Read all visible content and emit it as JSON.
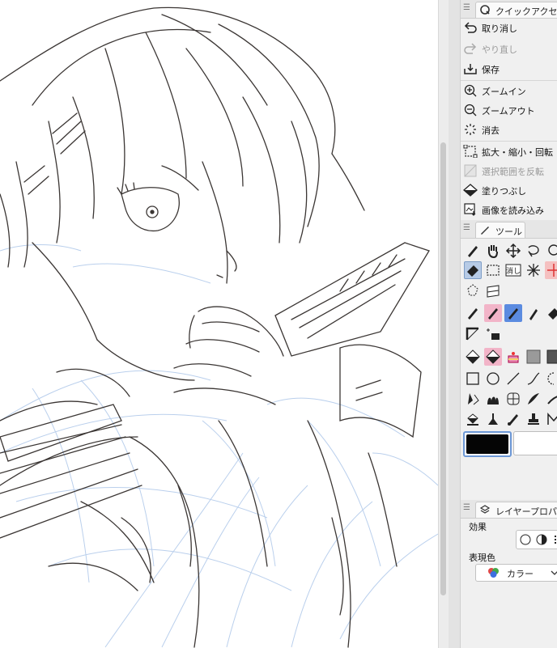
{
  "quick_access": {
    "tab_label": "クイックアクセス",
    "items": [
      {
        "label": "取り消し",
        "icon": "undo-icon",
        "disabled": false
      },
      {
        "label": "やり直し",
        "icon": "redo-icon",
        "disabled": true
      },
      {
        "label": "保存",
        "icon": "save-icon",
        "disabled": false
      },
      {
        "label": "ズームイン",
        "icon": "zoom-in-icon",
        "disabled": false
      },
      {
        "label": "ズームアウト",
        "icon": "zoom-out-icon",
        "disabled": false
      },
      {
        "label": "消去",
        "icon": "clear-icon",
        "disabled": false
      },
      {
        "label": "拡大・縮小・回転",
        "icon": "transform-icon",
        "disabled": false
      },
      {
        "label": "選択範囲を反転",
        "icon": "invert-selection-icon",
        "disabled": true
      },
      {
        "label": "塗りつぶし",
        "icon": "fill-icon",
        "disabled": false
      },
      {
        "label": "画像を読み込み",
        "icon": "import-image-icon",
        "disabled": false
      }
    ]
  },
  "tool_panel": {
    "tab_label": "ツール",
    "clear_button_label": "消し"
  },
  "colors": {
    "main": "#050505",
    "sub": "#ffffff",
    "accent": "#6d98d6"
  },
  "layer_property": {
    "tab_label": "レイヤープロパティ",
    "effect_label": "効果",
    "expression_color_label": "表現色",
    "expression_color_value": "カラー"
  }
}
